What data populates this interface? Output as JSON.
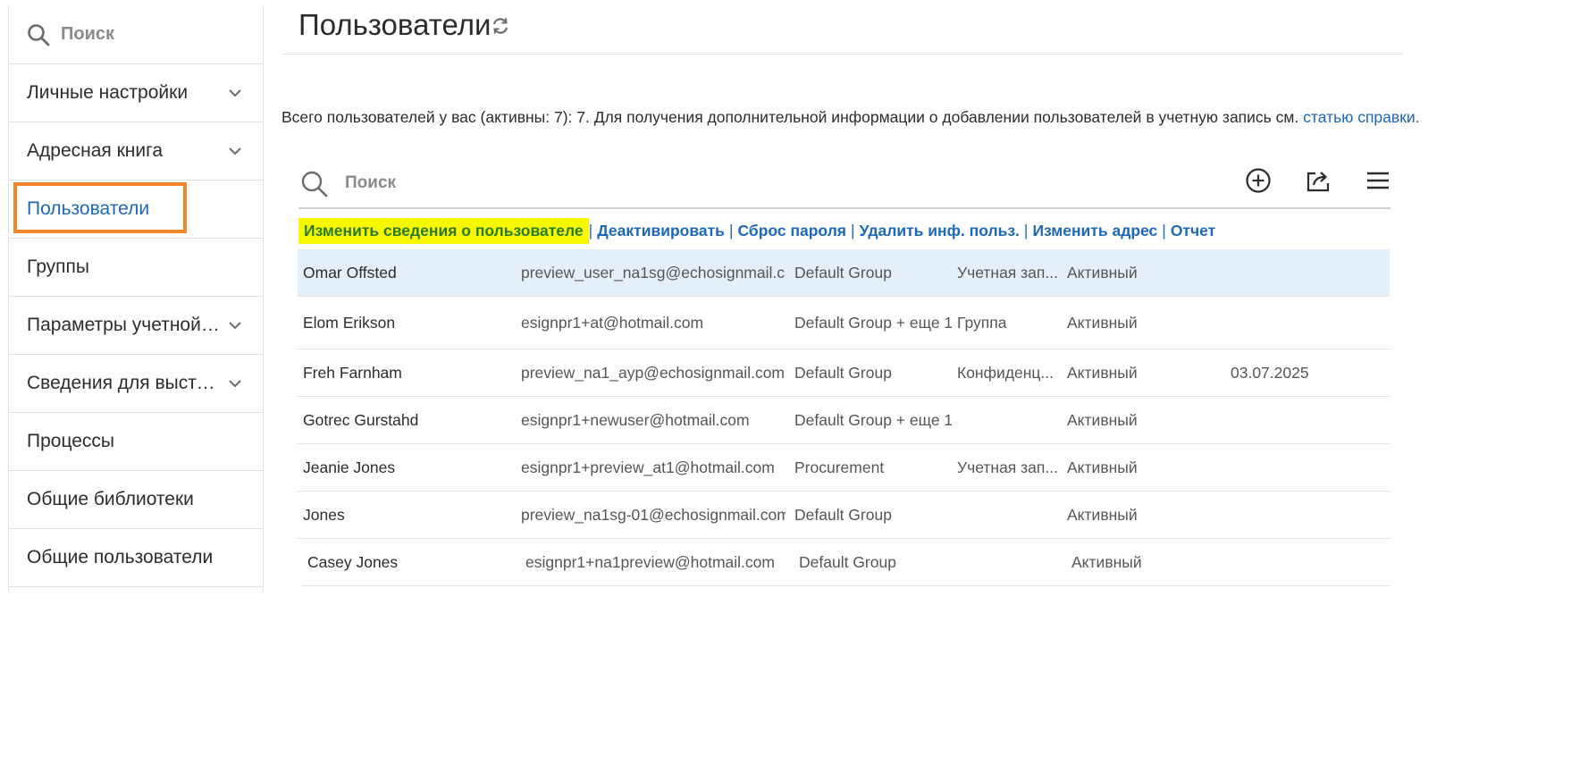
{
  "sidebar": {
    "search_placeholder": "Поиск",
    "items": [
      {
        "label": "Личные настройки",
        "expandable": true
      },
      {
        "label": "Адресная книга",
        "expandable": true
      },
      {
        "label": "Пользователи",
        "expandable": false,
        "active": true
      },
      {
        "label": "Группы",
        "expandable": false
      },
      {
        "label": "Параметры учетной записи",
        "expandable": true
      },
      {
        "label": "Сведения для выставления счетов",
        "expandable": true
      },
      {
        "label": "Процессы",
        "expandable": false
      },
      {
        "label": "Общие библиотеки",
        "expandable": false
      },
      {
        "label": "Общие пользователи",
        "expandable": false
      }
    ]
  },
  "header": {
    "title": "Пользователи"
  },
  "info": {
    "text": "Всего пользователей у вас (активны: 7): 7. Для получения дополнительной информации о добавлении пользователей в учетную запись см. ",
    "link": "статью справки."
  },
  "toolbar": {
    "search_placeholder": "Поиск"
  },
  "actions": [
    {
      "label": "Изменить сведения о пользователе",
      "highlighted": true
    },
    {
      "label": "Деактивировать"
    },
    {
      "label": "Сброс пароля"
    },
    {
      "label": "Удалить инф. польз."
    },
    {
      "label": "Изменить адрес"
    },
    {
      "label": "Отчет"
    }
  ],
  "users": [
    {
      "name": "Omar Offsted",
      "email": "preview_user_na1sg@echosignmail.c...",
      "group": "Default Group",
      "type": "Учетная зап...",
      "status": "Активный",
      "date": "",
      "selected": true
    },
    {
      "name": "Elom Erikson",
      "email": "esignpr1+at@hotmail.com",
      "group": "Default Group + еще 1",
      "type": "Группа",
      "status": "Активный",
      "date": ""
    },
    {
      "name": "Freh Farnham",
      "email": "preview_na1_ayp@echosignmail.com",
      "group": "Default Group",
      "type": "Конфиденц...",
      "status": "Активный",
      "date": "03.07.2025"
    },
    {
      "name": "Gotrec Gurstahd",
      "email": "esignpr1+newuser@hotmail.com",
      "group": "Default Group + еще 1",
      "type": "",
      "status": "Активный",
      "date": ""
    },
    {
      "name": "Jeanie Jones",
      "email": "esignpr1+preview_at1@hotmail.com",
      "group": "Procurement",
      "type": "Учетная зап...",
      "status": "Активный",
      "date": ""
    },
    {
      "name": "Jones",
      "email": "preview_na1sg-01@echosignmail.com",
      "group": "Default Group",
      "type": "",
      "status": "Активный",
      "date": ""
    },
    {
      "name": "Casey Jones",
      "email": "esignpr1+na1preview@hotmail.com",
      "group": "Default Group",
      "type": "",
      "status": "Активный",
      "date": ""
    }
  ],
  "colors": {
    "accent_link": "#1d68b8",
    "active_outline": "#f2872d",
    "highlight_bg": "#f7f700",
    "highlight_text": "#2a7a2a",
    "selected_row_bg": "#e4eff9"
  }
}
